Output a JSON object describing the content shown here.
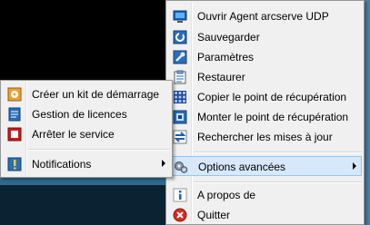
{
  "main_menu": {
    "items": [
      {
        "label": "Ouvrir Agent arcserve UDP"
      },
      {
        "label": "Sauvegarder"
      },
      {
        "label": "Paramètres"
      },
      {
        "label": "Restaurer"
      },
      {
        "label": "Copier le point de récupération"
      },
      {
        "label": "Monter le point de récupération"
      },
      {
        "label": "Rechercher les mises à jour"
      },
      {
        "label": "Options avancées"
      },
      {
        "label": "A propos de"
      },
      {
        "label": "Quitter"
      }
    ]
  },
  "sub_menu": {
    "items": [
      {
        "label": "Créer un kit de démarrage"
      },
      {
        "label": "Gestion de licences"
      },
      {
        "label": "Arrêter le service"
      },
      {
        "label": "Notifications"
      }
    ]
  },
  "colors": {
    "highlight": "#d6e8fa",
    "menu_background": "#f0f0f0",
    "quit_icon": "#d62b20"
  }
}
